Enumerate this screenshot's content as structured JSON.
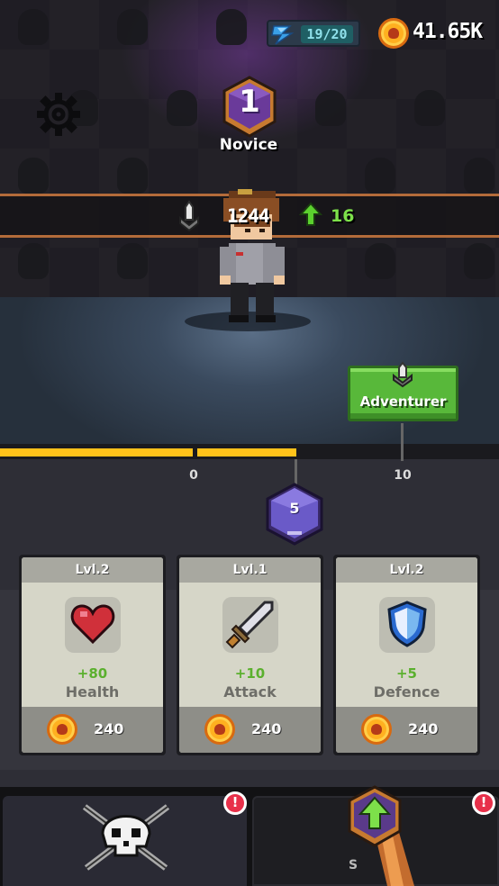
{
  "energy": {
    "value": "19/20",
    "icon": "lightning-icon"
  },
  "coins": {
    "total": "41.65K",
    "icon": "coin-icon"
  },
  "rank": {
    "number": "1",
    "title": "Novice"
  },
  "power": {
    "value": "1244",
    "gain": "16"
  },
  "class_button": {
    "label": "Adventurer"
  },
  "progress": {
    "low": "0",
    "high": "10",
    "fill_fraction": 0.59
  },
  "gems": {
    "value": "5"
  },
  "cards": [
    {
      "level": "Lvl.2",
      "bonus": "+80",
      "stat": "Health",
      "price": "240",
      "icon": "heart-icon"
    },
    {
      "level": "Lvl.1",
      "bonus": "+10",
      "stat": "Attack",
      "price": "240",
      "icon": "sword-icon"
    },
    {
      "level": "Lvl.2",
      "bonus": "+5",
      "stat": "Defence",
      "price": "240",
      "icon": "shield-icon"
    }
  ],
  "nav": {
    "tab2_label": "S",
    "badge": "!"
  },
  "colors": {
    "accent_gold": "#ffc21a",
    "accent_green": "#58b83a",
    "gem_purple": "#6a5ac8",
    "badge_red": "#e8304a"
  }
}
